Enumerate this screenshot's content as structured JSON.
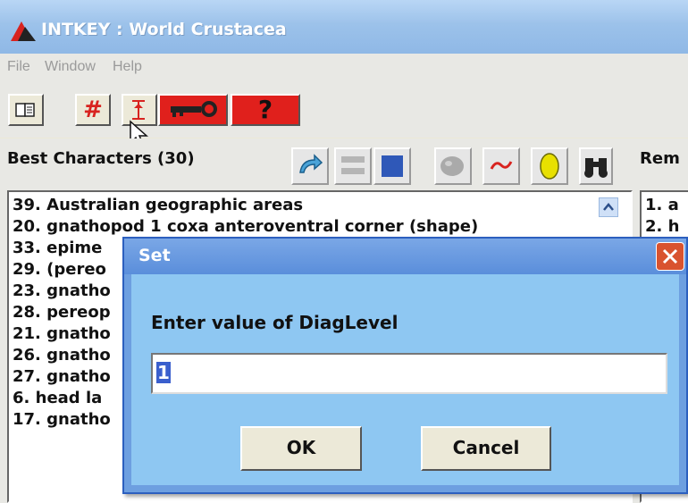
{
  "window": {
    "title": "INTKEY : World Crustacea"
  },
  "menu": {
    "items": [
      "File",
      "Window",
      "Help"
    ]
  },
  "toolbar": {
    "hash": "#",
    "question": "?"
  },
  "best_pane": {
    "title": "Best Characters (30)",
    "rows": [
      "39. Australian geographic areas",
      "20. gnathopod 1 coxa anteroventral corner (shape)",
      "33. epime",
      "29. (pereo",
      "23. gnatho",
      "28. pereop",
      "21. gnatho",
      "26. gnatho",
      "27. gnatho",
      "6. head la",
      "17. gnatho"
    ]
  },
  "remaining_pane": {
    "title": "Rem",
    "rows": [
      "1. a",
      "2. h"
    ]
  },
  "dialog": {
    "title": "Set",
    "prompt": "Enter value of DiagLevel",
    "value": "1",
    "ok_label": "OK",
    "cancel_label": "Cancel"
  },
  "colors": {
    "dialog_bg": "#8ec7f2",
    "titlebar": "#9cc2ea",
    "toolbar_red": "#e0201c"
  }
}
